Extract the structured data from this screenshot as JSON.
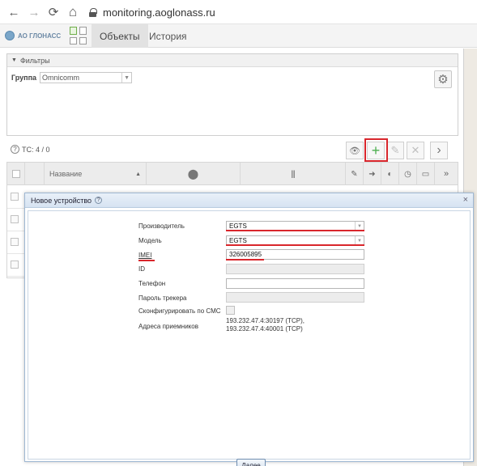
{
  "browser": {
    "url": "monitoring.aoglonass.ru",
    "back_glyph": "←",
    "forward_glyph": "→",
    "reload_glyph": "⟳",
    "home_glyph": "⌂"
  },
  "header": {
    "logo_text": "АО ГЛОНАСС",
    "tabs": [
      {
        "label": "Объекты",
        "active": true
      },
      {
        "label": "История",
        "active": false
      }
    ]
  },
  "filters": {
    "title": "Фильтры",
    "group_label": "Группа",
    "group_value": "Omnicomm"
  },
  "toolbar": {
    "count_text": "ТС: 4 / 0",
    "eye_glyph": "👁",
    "add_glyph": "+",
    "edit_glyph": "✎",
    "delete_glyph": "✕",
    "next_glyph": "›"
  },
  "grid": {
    "name_header": "Название",
    "sort_glyph": "▲",
    "location_glyph": "⬤",
    "barcode_glyph": "|||",
    "col_icons": [
      "✎",
      "➜",
      "◐",
      "◷",
      "▭",
      "»"
    ]
  },
  "modal": {
    "title": "Новое устройство",
    "close_glyph": "×",
    "fields": {
      "manufacturer": {
        "label": "Производитель",
        "value": "EGTS"
      },
      "model": {
        "label": "Модель",
        "value": "EGTS"
      },
      "imei": {
        "label": "IMEI",
        "value": "326005895"
      },
      "id": {
        "label": "ID",
        "value": ""
      },
      "phone": {
        "label": "Телефон",
        "value": ""
      },
      "tracker_password": {
        "label": "Пароль трекера",
        "value": ""
      },
      "sms_config": {
        "label": "Сконфигурировать по СМС"
      },
      "receivers": {
        "label": "Адреса приемников",
        "lines": [
          "193.232.47.4:30197 (TCP),",
          "193.232.47.4:40001 (TCP)"
        ]
      }
    },
    "next_label": "Далее"
  },
  "colors": {
    "accent_red": "#d9262c",
    "add_green": "#4caf50",
    "modal_header": "#d6e3f2"
  }
}
